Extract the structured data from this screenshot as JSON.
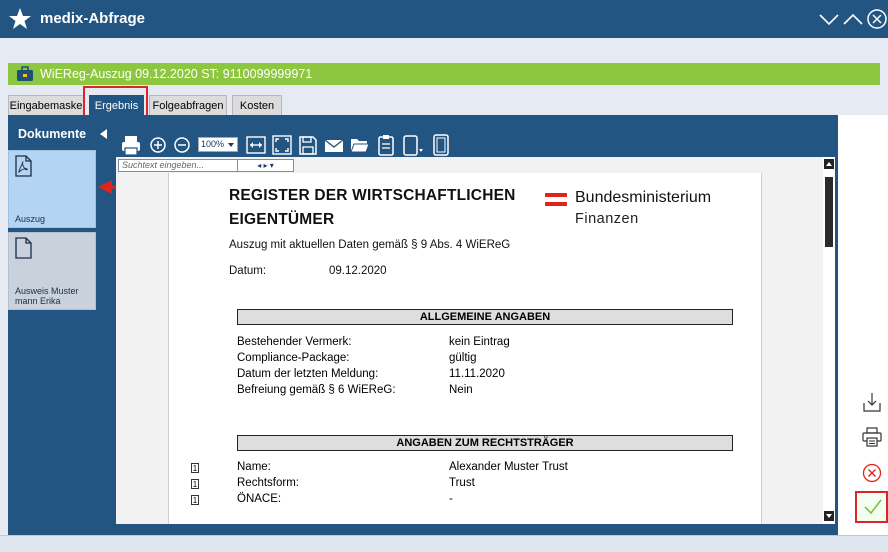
{
  "window": {
    "title": "medix-Abfrage",
    "star_icon": "star-icon",
    "controls": [
      "minimize-chevron-icon",
      "maximize-chevron-icon",
      "close-circle-icon"
    ]
  },
  "record_bar": {
    "title": "WiEReg-Auszug 09.12.2020 ST: 9110099999971",
    "icon": "document-case-icon",
    "color": "#8dc63f"
  },
  "tabs": [
    {
      "label": "Eingabemaske",
      "active": false
    },
    {
      "label": "Ergebnis",
      "active": true
    },
    {
      "label": "Folgeabfragen",
      "active": false
    },
    {
      "label": "Kosten",
      "active": false
    }
  ],
  "documents": {
    "header": "Dokumente",
    "items": [
      {
        "label": "Auszug",
        "icon": "pdf-file-icon",
        "selected": true
      },
      {
        "label": "Ausweis Muster mann Erika",
        "icon": "file-icon",
        "selected": false
      }
    ]
  },
  "toolbar": {
    "zoom": "100%",
    "icons": [
      "print-icon",
      "zoom-in-icon",
      "zoom-out-icon",
      "fit-width-icon",
      "fit-page-icon",
      "save-icon",
      "mail-icon",
      "open-folder-icon",
      "clipboard-icon",
      "page-orientation-icon",
      "tablet-icon"
    ]
  },
  "search": {
    "placeholder": "Suchtext eingeben...",
    "nav": "◂ ▸ ▾"
  },
  "document": {
    "heading_line1": "REGISTER DER WIRTSCHAFTLICHEN",
    "heading_line2": "EIGENTÜMER",
    "logo_line1": "Bundesministerium",
    "logo_line2": "Finanzen",
    "subtitle": "Auszug mit aktuellen Daten gemäß § 9 Abs. 4 WiEReG",
    "date_label": "Datum:",
    "date_value": "09.12.2020",
    "section1": {
      "title": "ALLGEMEINE ANGABEN",
      "rows": [
        {
          "key": "Bestehender Vermerk:",
          "value": "kein Eintrag"
        },
        {
          "key": "Compliance-Package:",
          "value": "gültig"
        },
        {
          "key": "Datum der letzten Meldung:",
          "value": "11.11.2020"
        },
        {
          "key": "Befreiung gemäß § 6 WiEReG:",
          "value": "Nein"
        }
      ]
    },
    "section2": {
      "title": "ANGABEN ZUM RECHTSTRÄGER",
      "rows": [
        {
          "num": "1",
          "key": "Name:",
          "value": "Alexander Muster Trust"
        },
        {
          "num": "1",
          "key": "Rechtsform:",
          "value": "Trust"
        },
        {
          "num": "1",
          "key": "ÖNACE:",
          "value": "-"
        }
      ]
    }
  },
  "right_actions": [
    "download-icon",
    "print-icon",
    "cancel-icon",
    "confirm-check-icon"
  ],
  "colors": {
    "primary": "#225582",
    "accent_green": "#8dc63f",
    "highlight_red": "#d9262c"
  }
}
